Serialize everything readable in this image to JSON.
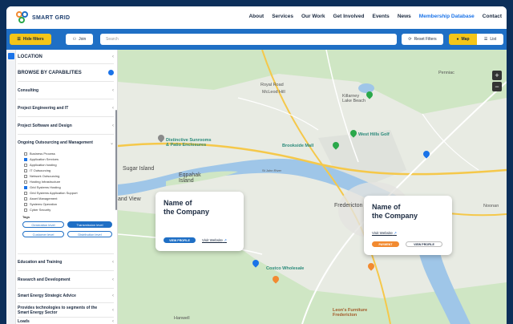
{
  "brand": {
    "name": "SMART GRID",
    "colors": {
      "primary": "#1f6fc5",
      "accent": "#f4c518",
      "orange": "#f28a30"
    }
  },
  "nav": {
    "items": [
      "About",
      "Services",
      "Our Work",
      "Get Involved",
      "Events",
      "News",
      "Membership Database",
      "Contact"
    ],
    "active": "Membership Database"
  },
  "toolbar": {
    "hide_filters": "Hide filters",
    "join": "Join",
    "search_placeholder": "Search",
    "reset_filters": "Reset Filters",
    "map": "Map",
    "list": "List"
  },
  "sidebar": {
    "location": "LOCATION",
    "browse": "BROWSE BY CAPABILITIES",
    "sections": [
      "Consulting",
      "Project Engineering and IT",
      "Project Software and Design",
      "Ongoing Outsourcing and Management",
      "Education and Training",
      "Research and Development",
      "Smart Energy Strategic Advice",
      "Provides technologies to segments of the Smart Energy Sector",
      "Loads"
    ],
    "sub_items": [
      {
        "label": "Business Process",
        "checked": false
      },
      {
        "label": "Application Services",
        "checked": true
      },
      {
        "label": "Application hosting",
        "checked": false
      },
      {
        "label": "IT Outsourcing",
        "checked": false
      },
      {
        "label": "Network Outsourcing",
        "checked": false
      },
      {
        "label": "Hosting Infrastructure",
        "checked": false
      },
      {
        "label": "Grid Systems Hosting",
        "checked": true
      },
      {
        "label": "Grid Systems Application Support",
        "checked": false
      },
      {
        "label": "Asset Management",
        "checked": false
      },
      {
        "label": "Systems Operation",
        "checked": false
      },
      {
        "label": "Cyber Security",
        "checked": false
      }
    ],
    "tags_label": "Tags",
    "tags": [
      {
        "label": "Generation level",
        "active": false
      },
      {
        "label": "Transmission level",
        "active": true
      },
      {
        "label": "Customer level",
        "active": false
      },
      {
        "label": "Distribution level",
        "active": false
      }
    ]
  },
  "map": {
    "labels": {
      "royal_road": "Royal Road",
      "mcleod_hill": "McLeod Hill",
      "killarney": "Killarney\nLake Beach",
      "penniac": "Penniac",
      "distinctive": "Distinctive Sunrooms\n& Patio Enclosures",
      "brookside": "Brookside Mall",
      "west_hills": "West Hills Golf",
      "sugar_island": "Sugar Island",
      "eqbaak": "Eqpahak\nIsland",
      "st_john": "St John River",
      "fredericton": "Fredericton",
      "noonan": "Noonan",
      "costco": "Costco Wholesale",
      "leons": "Leon's Furniture\nFredericton",
      "hanwell": "Hanwell",
      "and_view": "and View"
    },
    "zoom_in": "+",
    "zoom_out": "−"
  },
  "cards": [
    {
      "title": "Name of\nthe Company",
      "view_profile": "VIEW PROFILE",
      "visit_website": "Visit Website"
    },
    {
      "title": "Name of\nthe Company",
      "visit_website": "Visit Website",
      "payment": "PAYMENT",
      "view_profile": "VIEW PROFILE"
    }
  ]
}
